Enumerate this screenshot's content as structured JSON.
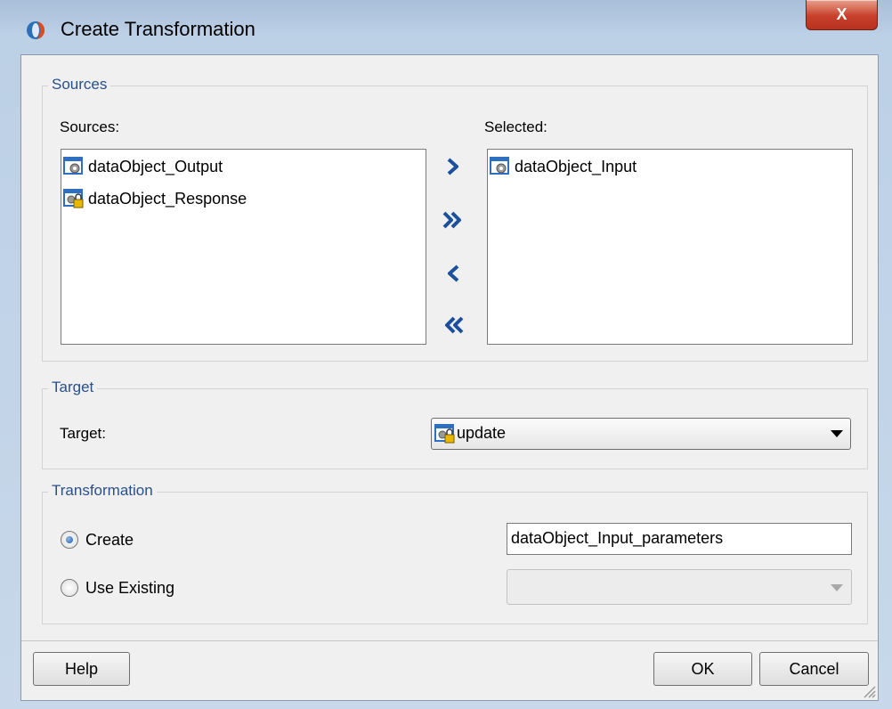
{
  "window": {
    "title": "Create Transformation",
    "close_glyph": "X",
    "accent_color": "#c8402a"
  },
  "sources_group": {
    "title": "Sources",
    "sources_label": "Sources:",
    "selected_label": "Selected:",
    "sources_list": [
      {
        "label": "dataObject_Output",
        "icon": "data-object-gear-icon"
      },
      {
        "label": "dataObject_Response",
        "icon": "data-object-locked-icon"
      }
    ],
    "selected_list": [
      {
        "label": "dataObject_Input",
        "icon": "data-object-gear-icon"
      }
    ],
    "shuttle_buttons": [
      "move-right",
      "move-all-right",
      "move-left",
      "move-all-left"
    ]
  },
  "target_group": {
    "title": "Target",
    "label": "Target:",
    "selected_value": "update",
    "icon": "data-object-locked-icon"
  },
  "transformation_group": {
    "title": "Transformation",
    "create_label": "Create",
    "use_existing_label": "Use Existing",
    "selected_option": "Create",
    "create_name_value": "dataObject_Input_parameters",
    "existing_value": ""
  },
  "buttons": {
    "help": "Help",
    "ok": "OK",
    "cancel": "Cancel"
  }
}
